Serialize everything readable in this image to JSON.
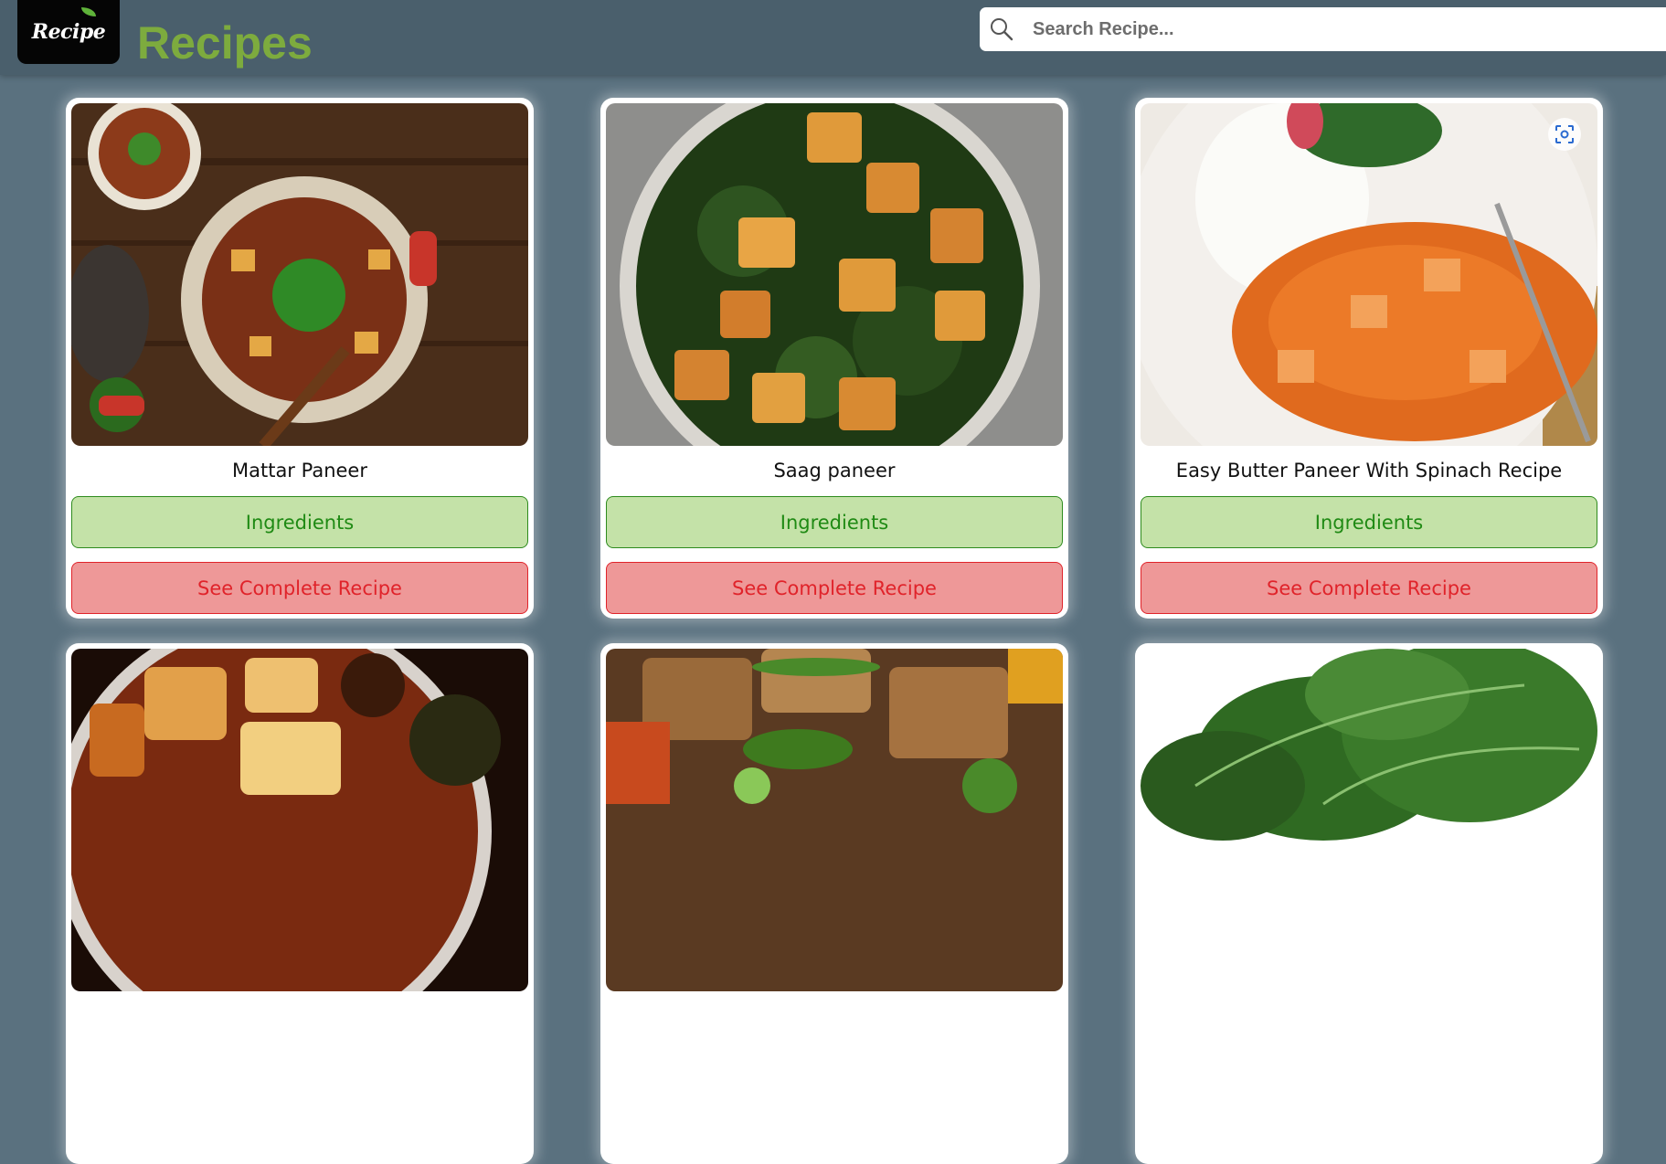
{
  "header": {
    "logo_text": "Recipe",
    "title": "Recipes",
    "search_placeholder": "Search Recipe..."
  },
  "recipes": [
    {
      "title": "Mattar Paneer",
      "ingredients_label": "Ingredients",
      "recipe_label": "See Complete Recipe"
    },
    {
      "title": "Saag paneer",
      "ingredients_label": "Ingredients",
      "recipe_label": "See Complete Recipe"
    },
    {
      "title": "Easy Butter Paneer With Spinach Recipe",
      "ingredients_label": "Ingredients",
      "recipe_label": "See Complete Recipe"
    },
    {
      "title": "",
      "ingredients_label": "",
      "recipe_label": ""
    },
    {
      "title": "",
      "ingredients_label": "",
      "recipe_label": ""
    },
    {
      "title": "",
      "ingredients_label": "",
      "recipe_label": ""
    }
  ],
  "colors": {
    "background": "#5a717f",
    "header": "#4a5f6c",
    "title": "#7dab3e",
    "ingredients_bg": "#c4e2a8",
    "ingredients_text": "#1f8a14",
    "recipe_bg": "#ee9898",
    "recipe_text": "#e0232a"
  },
  "icons": [
    "search-icon",
    "visual-search-icon"
  ]
}
